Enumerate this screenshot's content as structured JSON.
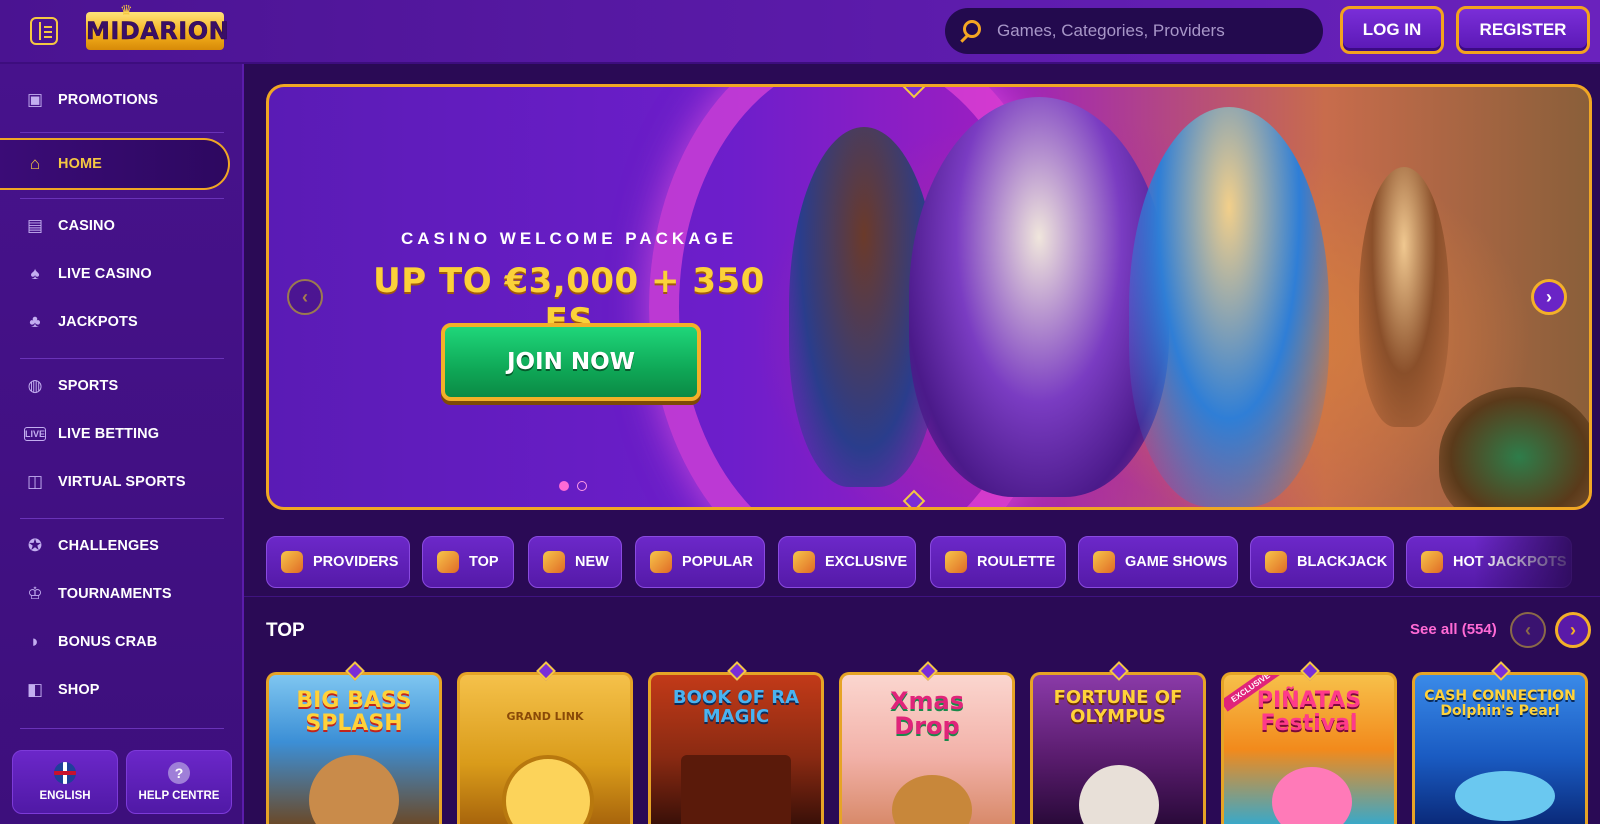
{
  "header": {
    "logo": "MIDARION",
    "search_placeholder": "Games, Categories, Providers",
    "login": "LOG IN",
    "register": "REGISTER"
  },
  "sidebar": {
    "items": [
      {
        "label": "PROMOTIONS",
        "icon": "gift-icon"
      },
      {
        "label": "HOME",
        "icon": "home-icon",
        "active": true
      },
      {
        "label": "CASINO",
        "icon": "slot-machine-icon"
      },
      {
        "label": "LIVE CASINO",
        "icon": "playing-card-icon"
      },
      {
        "label": "JACKPOTS",
        "icon": "clover-icon"
      },
      {
        "label": "SPORTS",
        "icon": "ball-icon"
      },
      {
        "label": "LIVE BETTING",
        "icon": "live-badge-icon"
      },
      {
        "label": "VIRTUAL SPORTS",
        "icon": "gamepad-icon"
      },
      {
        "label": "CHALLENGES",
        "icon": "medal-icon"
      },
      {
        "label": "TOURNAMENTS",
        "icon": "trophy-icon"
      },
      {
        "label": "BONUS CRAB",
        "icon": "crab-claw-icon"
      },
      {
        "label": "SHOP",
        "icon": "shopping-bag-icon"
      }
    ],
    "language": "ENGLISH",
    "help": "HELP CENTRE",
    "help_icon_glyph": "?"
  },
  "hero": {
    "subtitle": "CASINO WELCOME PACKAGE",
    "title": "UP TO €3,000 + 350 FS",
    "cta": "JOIN NOW",
    "prev_glyph": "‹",
    "next_glyph": "›"
  },
  "categories": [
    {
      "label": "PROVIDERS",
      "icon": "scroll-icon"
    },
    {
      "label": "TOP",
      "icon": "gift-box-icon"
    },
    {
      "label": "NEW",
      "icon": "bell-icon"
    },
    {
      "label": "POPULAR",
      "icon": "star-icon"
    },
    {
      "label": "EXCLUSIVE",
      "icon": "gem-icon"
    },
    {
      "label": "ROULETTE",
      "icon": "roulette-icon"
    },
    {
      "label": "GAME SHOWS",
      "icon": "microphone-icon"
    },
    {
      "label": "BLACKJACK",
      "icon": "cards-icon"
    },
    {
      "label": "HOT JACKPOTS",
      "icon": "fire-coins-icon"
    }
  ],
  "top_section": {
    "title": "TOP",
    "see_all": "See all (554)",
    "prev_glyph": "‹",
    "next_glyph": "›",
    "games": [
      {
        "title": "BIG BASS\nSPLASH",
        "color": "#3c8fd6"
      },
      {
        "title": "GRAND LINK",
        "color": "#d99b1a"
      },
      {
        "title": "BOOK OF RA\nMAGIC",
        "color": "#8a2a12"
      },
      {
        "title": "Xmas\nDrop",
        "color": "#f2b1a8"
      },
      {
        "title": "FORTUNE OF\nOLYMPUS",
        "color": "#5a1c6e"
      },
      {
        "title": "PIÑATAS\nFestival",
        "color": "#f28a1c",
        "badge": "EXCLUSIVE"
      },
      {
        "title": "CASH CONNECTION\nDolphin's Pearl",
        "color": "#1a5bc2"
      }
    ]
  }
}
